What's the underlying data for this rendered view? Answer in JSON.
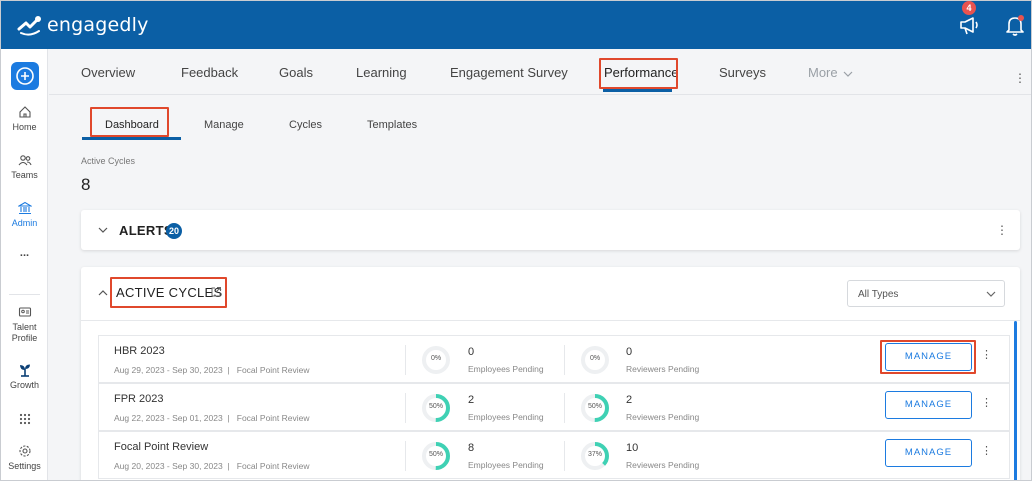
{
  "app": {
    "logo_text": "engagedly",
    "notification_count": "4"
  },
  "sidebar": {
    "items": [
      {
        "label": "Home"
      },
      {
        "label": "Teams"
      },
      {
        "label": "Admin"
      },
      {
        "label": "..."
      },
      {
        "label": "Talent Profile"
      },
      {
        "label": "Growth"
      },
      {
        "label": "Settings"
      }
    ]
  },
  "nav": {
    "tabs": [
      "Overview",
      "Feedback",
      "Goals",
      "Learning",
      "Engagement Survey",
      "Performance",
      "Surveys",
      "More"
    ],
    "active": "Performance"
  },
  "subnav": {
    "tabs": [
      "Dashboard",
      "Manage",
      "Cycles",
      "Templates"
    ],
    "active": "Dashboard"
  },
  "summary": {
    "active_cycles_label": "Active Cycles",
    "active_cycles_value": "8"
  },
  "alerts": {
    "title": "ALERTS",
    "count": "20"
  },
  "cycles": {
    "title": "ACTIVE CYCLES",
    "filter_value": "All Types",
    "manage_label": "MANAGE",
    "rows": [
      {
        "name": "HBR 2023",
        "dates": "Aug 29, 2023 - Sep 30, 2023",
        "sep": "|",
        "template": "Focal Point Review",
        "emp_pct": "0%",
        "emp_pct_value": 0,
        "emp_count": "0",
        "emp_label": "Employees Pending",
        "rev_pct": "0%",
        "rev_pct_value": 0,
        "rev_count": "0",
        "rev_label": "Reviewers Pending"
      },
      {
        "name": "FPR 2023",
        "dates": "Aug 22, 2023 - Sep 01, 2023",
        "sep": "|",
        "template": "Focal Point Review",
        "emp_pct": "50%",
        "emp_pct_value": 50,
        "emp_count": "2",
        "emp_label": "Employees Pending",
        "rev_pct": "50%",
        "rev_pct_value": 50,
        "rev_count": "2",
        "rev_label": "Reviewers Pending"
      },
      {
        "name": "Focal Point Review",
        "dates": "Aug 20, 2023 - Sep 30, 2023",
        "sep": "|",
        "template": "Focal Point Review",
        "emp_pct": "50%",
        "emp_pct_value": 50,
        "emp_count": "8",
        "emp_label": "Employees Pending",
        "rev_pct": "37%",
        "rev_pct_value": 37,
        "rev_count": "10",
        "rev_label": "Reviewers Pending"
      }
    ]
  },
  "colors": {
    "brand": "#0b5fa5",
    "accent": "#1c7be0",
    "progress": "#3fd1b4",
    "highlight": "#e0482c"
  }
}
